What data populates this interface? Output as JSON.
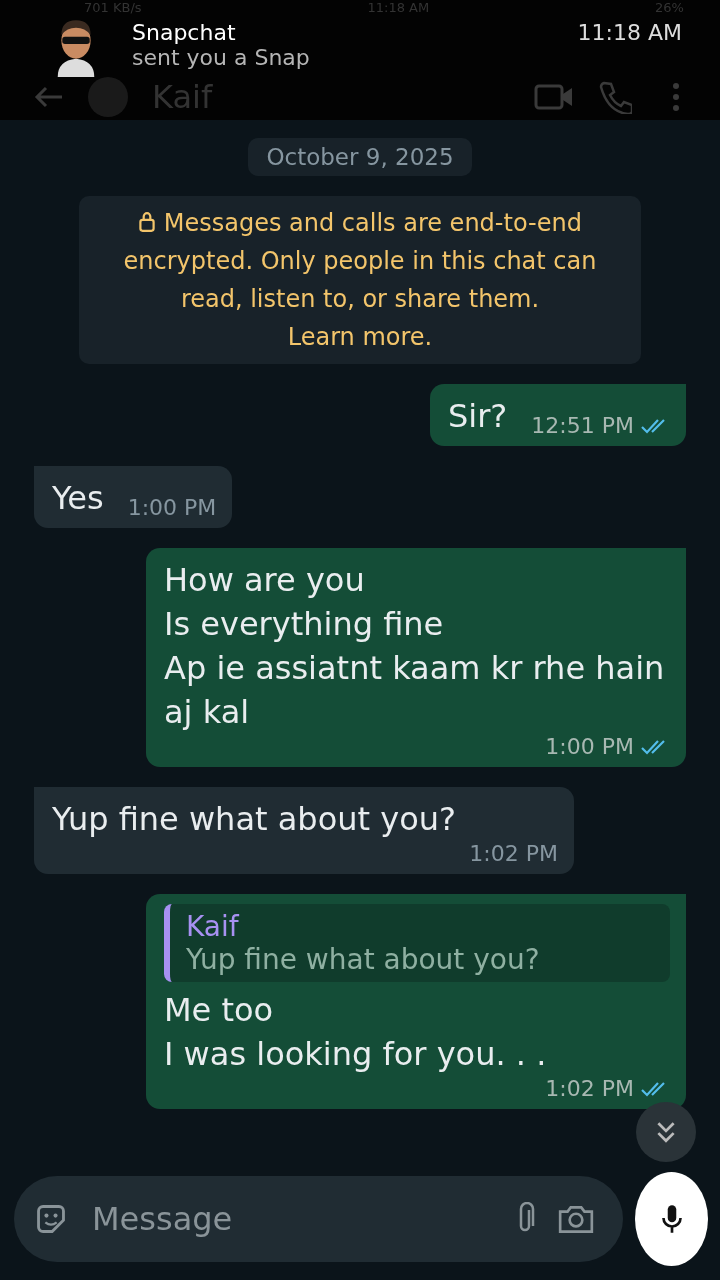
{
  "status_bar": {
    "network_speed": "701 KB/s",
    "time": "11:18 AM",
    "battery": "26%"
  },
  "notification": {
    "app": "Snapchat",
    "text": "sent you a Snap",
    "time": "11:18 AM"
  },
  "header": {
    "contact": "Kaif"
  },
  "date_chip": "October 9, 2025",
  "encryption_notice": {
    "text": "Messages and calls are end-to-end encrypted. Only people in this chat can read, listen to, or share them.",
    "link": "Learn more."
  },
  "messages": [
    {
      "kind": "outgoing",
      "lines": [
        "Sir?"
      ],
      "time": "12:51 PM",
      "read": true
    },
    {
      "kind": "incoming",
      "lines": [
        "Yes"
      ],
      "time": "1:00 PM"
    },
    {
      "kind": "outgoing",
      "lines": [
        "How are you",
        "Is everything fine",
        "Ap ie assiatnt kaam kr rhe hain aj kal"
      ],
      "time": "1:00 PM",
      "read": true
    },
    {
      "kind": "incoming",
      "lines": [
        "Yup fine what about you?"
      ],
      "time": "1:02 PM"
    },
    {
      "kind": "outgoing",
      "quote": {
        "author": "Kaif",
        "text": "Yup fine what about you?"
      },
      "lines": [
        "Me too",
        "I was looking for you. . ."
      ],
      "time": "1:02 PM",
      "read": true
    }
  ],
  "input": {
    "placeholder": "Message"
  }
}
